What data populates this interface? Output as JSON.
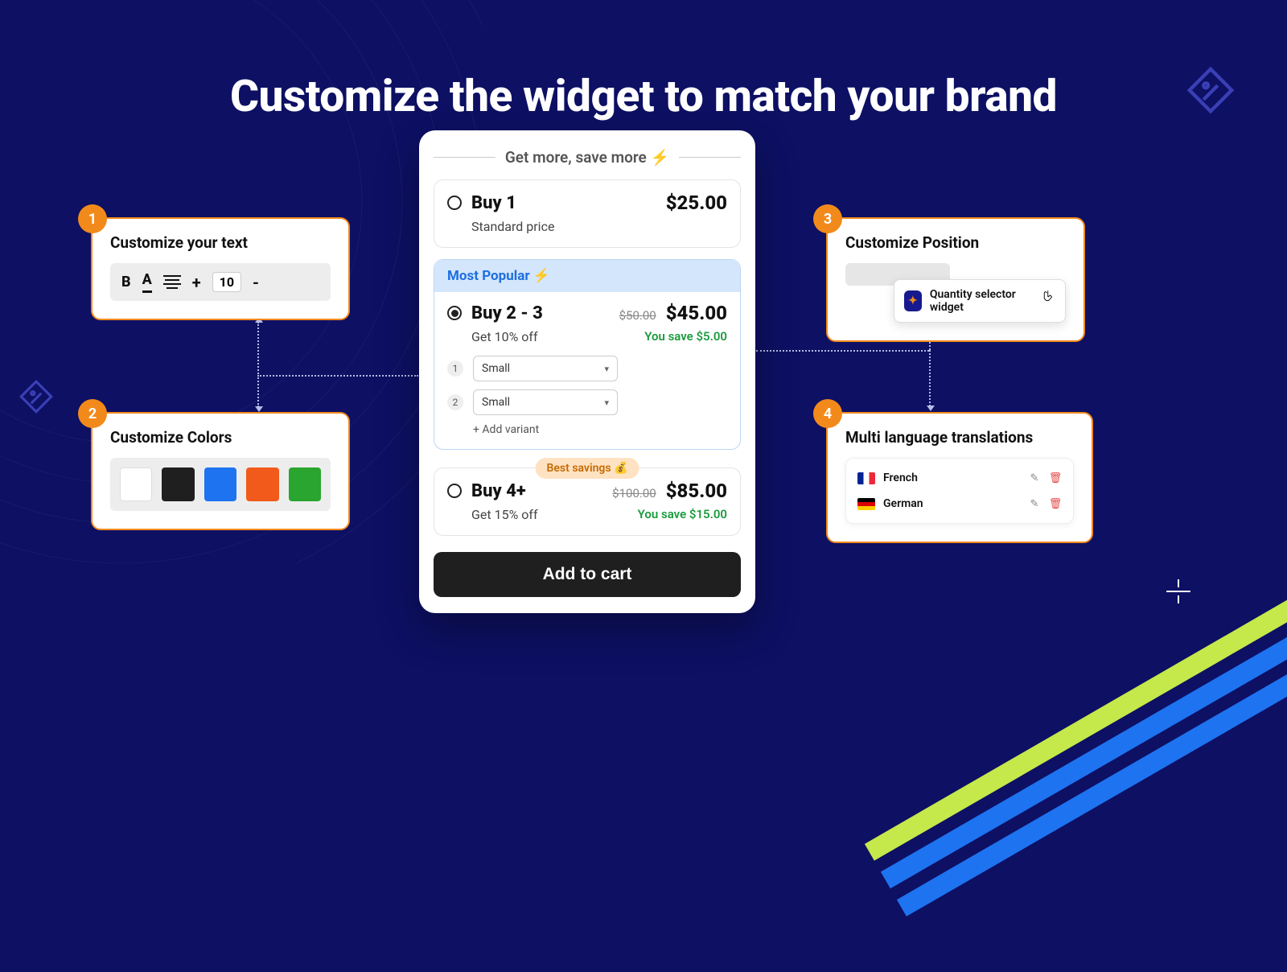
{
  "hero": {
    "title": "Customize the widget to match your brand"
  },
  "cards": {
    "text": {
      "num": "1",
      "title": "Customize your text",
      "bold": "B",
      "a": "A",
      "plus": "+",
      "font_size": "10",
      "minus": "-"
    },
    "colors": {
      "num": "2",
      "title": "Customize Colors",
      "swatches": [
        "#ffffff",
        "#1f1f1f",
        "#1e73f0",
        "#f25a1b",
        "#2aa52f"
      ]
    },
    "position": {
      "num": "3",
      "title": "Customize Position",
      "chip_label": "Quantity selector widget"
    },
    "translations": {
      "num": "4",
      "title": "Multi language translations",
      "langs": [
        {
          "name": "French"
        },
        {
          "name": "German"
        }
      ]
    }
  },
  "widget": {
    "header": "Get more, save more ⚡",
    "tiers": [
      {
        "title": "Buy 1",
        "price": "$25.00",
        "sub": "Standard price"
      },
      {
        "banner": "Most Popular ⚡",
        "title": "Buy 2 - 3",
        "strike": "$50.00",
        "price": "$45.00",
        "sub": "Get 10% off",
        "save": "You save $5.00",
        "variants": [
          {
            "n": "1",
            "val": "Small"
          },
          {
            "n": "2",
            "val": "Small"
          }
        ],
        "add_variant": "+ Add variant"
      },
      {
        "badge": "Best savings 💰",
        "title": "Buy 4+",
        "strike": "$100.00",
        "price": "$85.00",
        "sub": "Get 15% off",
        "save": "You save $15.00"
      }
    ],
    "cta": "Add to cart"
  }
}
